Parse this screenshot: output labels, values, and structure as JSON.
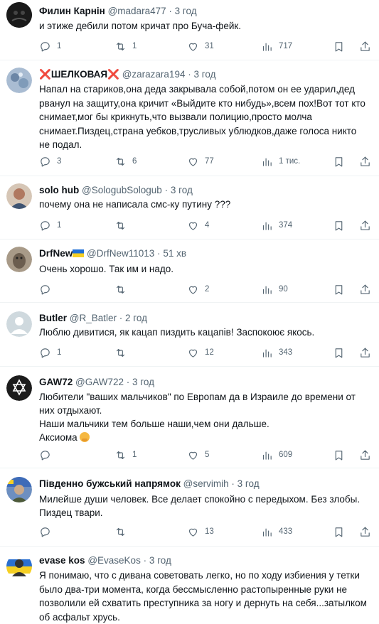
{
  "tweets": [
    {
      "name": "Филин Карнiн",
      "handle": "@madara477",
      "time": "3 год",
      "text": [
        "и этиже дебили потом кричат про Буча-фейк."
      ],
      "replies": "1",
      "retweets": "1",
      "likes": "31",
      "views": "717",
      "avatar_color": "#1b1b1b"
    },
    {
      "name_prefix": "❌",
      "name": "ШЕЛКОВАЯ",
      "name_suffix": "❌",
      "handle": "@zarazara194",
      "time": "3 год",
      "text": [
        "Напал на стариков,она деда закрывала собой,потом он ее ударил,дед рванул на защиту,она кричит «Выйдите кто нибудь»,всем пох!Вот тот кто снимает,мог бы крикнуть,что вызвали полицию,просто молча снимает.Пиздец,страна уебков,трусливых ублюдков,даже голоса никто не подал."
      ],
      "replies": "3",
      "retweets": "6",
      "likes": "77",
      "views": "1 тис.",
      "avatar_color": "#8fa8c4"
    },
    {
      "name": "solo hub",
      "handle": "@SologubSologub",
      "time": "3 год",
      "text": [
        "почему она не написала смс-ку путину ???"
      ],
      "replies": "1",
      "retweets": "",
      "likes": "4",
      "views": "374",
      "avatar_color": "#b98c74"
    },
    {
      "name": "DrfNew",
      "handle": "@DrfNew11013",
      "time": "51 хв",
      "text": [
        "Очень хорошо. Так им и надо."
      ],
      "replies": "",
      "retweets": "",
      "likes": "2",
      "views": "90",
      "avatar_color": "#8a7a6a"
    },
    {
      "name": "Butler",
      "handle": "@R_Batler",
      "time": "2 год",
      "text": [
        "Люблю дивитися, як кацап пиздить кацапів! Заспокоює якось."
      ],
      "replies": "1",
      "retweets": "",
      "likes": "12",
      "views": "343",
      "avatar_color": "#cfd9de"
    },
    {
      "name": "GAW72",
      "handle": "@GAW722",
      "time": "3 год",
      "text": [
        "Любители \"ваших мальчиков\" по Европам да в Израиле до времени от них отдыхают.",
        "Наши мальчики тем больше наши,чем они дальше.",
        "Аксиома"
      ],
      "replies": "",
      "retweets": "1",
      "likes": "5",
      "views": "609",
      "avatar_color": "#222222"
    },
    {
      "name": "Південно бужський напрямок",
      "handle": "@servimih",
      "time": "3 год",
      "text": [
        "Милейше души человек. Все делает спокойно с передыхом. Без злобы. Пиздец твари."
      ],
      "replies": "",
      "retweets": "",
      "likes": "13",
      "views": "433",
      "avatar_color": "#4a6fa5"
    },
    {
      "name": "evase kos",
      "handle": "@EvaseKos",
      "time": "3 год",
      "text": [
        "Я понимаю, что с дивана советовать легко, но по ходу избиения у тетки было два-три момента, когда бессмысленно растопыренные руки не позволили ей схватить преступника за ногу и дернуть на себя...затылком об асфальт хрусь."
      ],
      "replies": "",
      "retweets": "",
      "likes": "",
      "views": "",
      "avatar_color": "#f2d24a"
    }
  ],
  "separator": "·"
}
